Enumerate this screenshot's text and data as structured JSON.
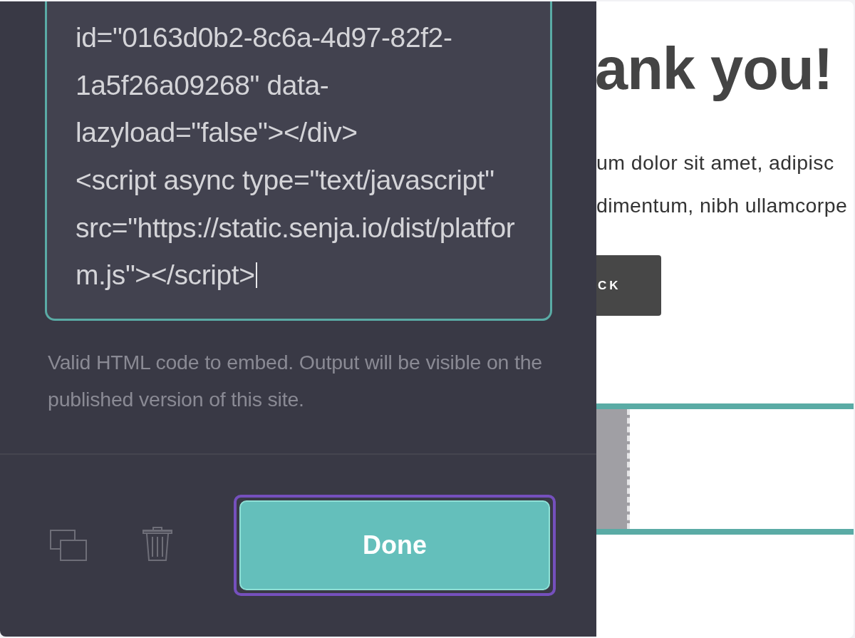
{
  "panel": {
    "code_field": {
      "lines": [
        "id=\"0163d0b2-8c6a-4d97-82f2-",
        "1a5f26a09268\" data-",
        "lazyload=\"false\"></div>",
        "<script async type=\"text/javascript\"",
        "src=\"https://static.senja.io/dist/platfor",
        "m.js\"></script>"
      ],
      "cursor": true
    },
    "help_text": "Valid HTML code to embed. Output will be visible on the published version of this site.",
    "done_button": {
      "label": "Done",
      "focused": true
    }
  },
  "page": {
    "heading": "ank you!",
    "paragraph_lines": [
      "um dolor sit amet, adipisc",
      "dimentum, nibh ullamcorpe"
    ],
    "back_button": {
      "label": "CK"
    }
  }
}
